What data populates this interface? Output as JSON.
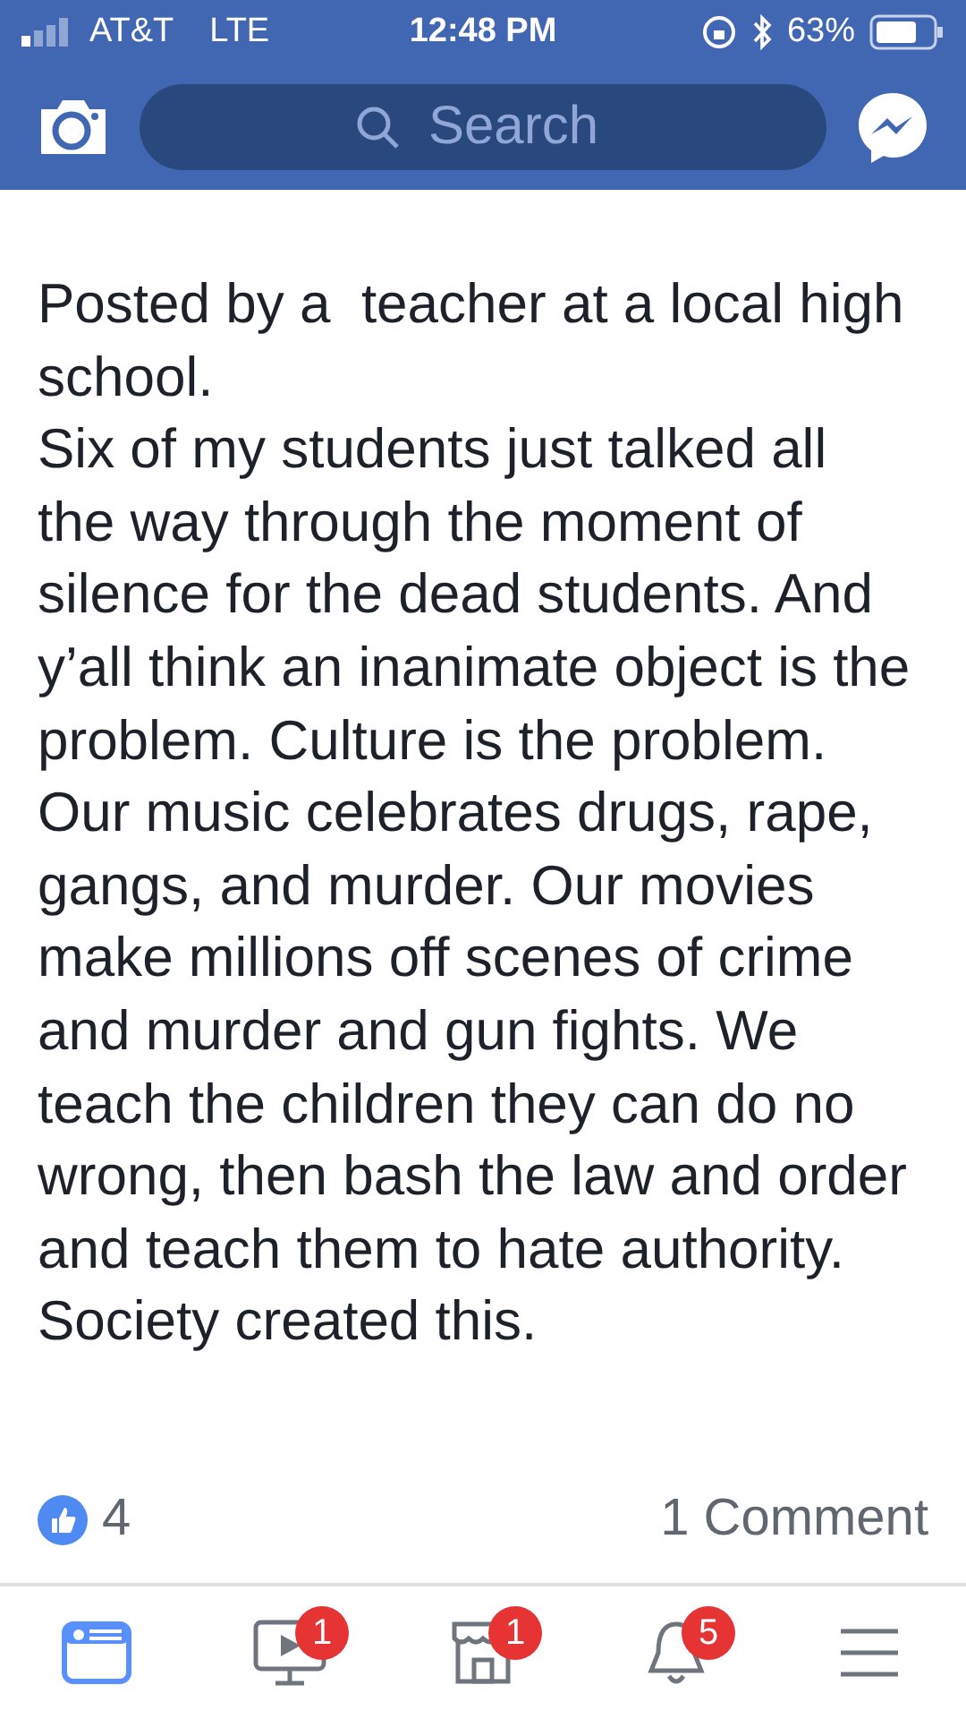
{
  "status_bar": {
    "carrier": "AT&T",
    "network": "LTE",
    "time": "12:48 PM",
    "battery": "63%"
  },
  "search": {
    "placeholder": "Search"
  },
  "post": {
    "paragraphs": [
      "Posted by a  teacher at a local high school.",
      "Six of my students just talked all the way through the moment of silence for the dead students. And y’all think an inanimate object is the problem. Culture is the problem. Our music celebrates drugs, rape, gangs, and murder. Our movies make millions off scenes of crime and murder and gun fights. We teach the children they can do no wrong, then bash the law and order and teach them to hate authority.",
      "Society created this."
    ],
    "likes": "4",
    "comments": "1 Comment"
  },
  "tabs": [
    {
      "kind": "feed",
      "selected": true
    },
    {
      "kind": "video",
      "selected": false,
      "badge": "1"
    },
    {
      "kind": "market",
      "selected": false,
      "badge": "1"
    },
    {
      "kind": "bell",
      "selected": false,
      "badge": "5"
    },
    {
      "kind": "menu",
      "selected": false
    }
  ]
}
